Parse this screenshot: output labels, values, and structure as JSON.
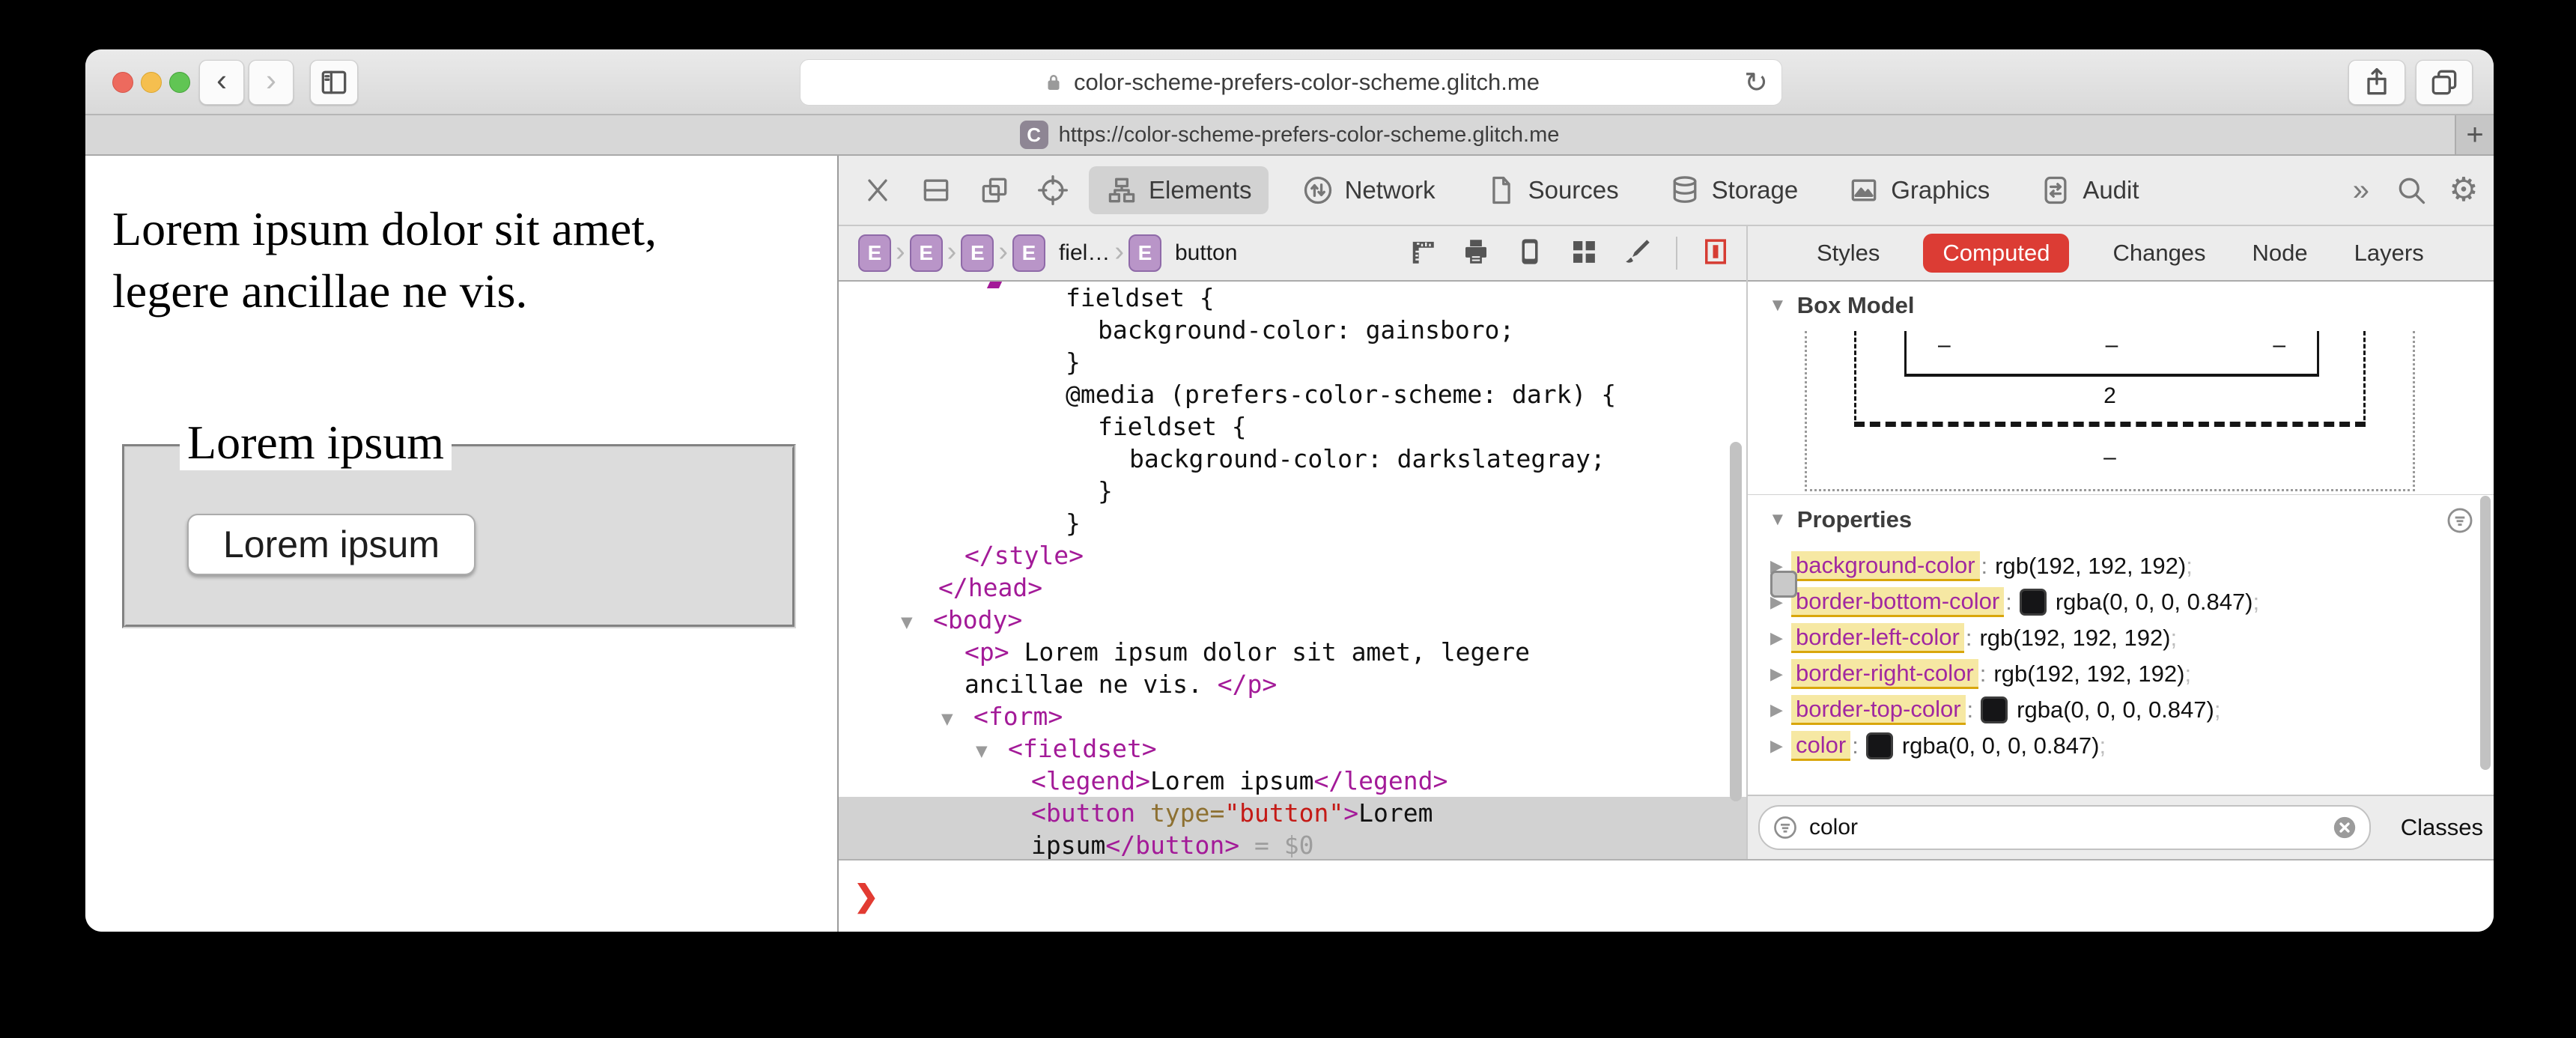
{
  "browser": {
    "back_glyph": "‹",
    "forward_glyph": "›",
    "url": "color-scheme-prefers-color-scheme.glitch.me",
    "reload_glyph": "↻",
    "tab": {
      "favicon_letter": "C",
      "url": "https://color-scheme-prefers-color-scheme.glitch.me"
    },
    "new_tab_glyph": "+"
  },
  "page": {
    "paragraph_line1": "Lorem ipsum dolor sit amet,",
    "paragraph_line2": "legere ancillae ne vis.",
    "fieldset_legend": "Lorem ipsum",
    "button_label": "Lorem ipsum"
  },
  "devtools": {
    "toolbar": {
      "left_buttons": [
        {
          "name": "close-devtools-button",
          "icon": "close-icon"
        },
        {
          "name": "dock-bottom-button",
          "icon": "dock-bottom-icon"
        },
        {
          "name": "dock-side-button",
          "icon": "dock-side-icon"
        },
        {
          "name": "inspect-element-button",
          "icon": "inspect-target-icon"
        }
      ],
      "tabs": [
        {
          "label": "Elements",
          "icon": "elements-icon",
          "selected": true
        },
        {
          "label": "Network",
          "icon": "network-icon",
          "selected": false
        },
        {
          "label": "Sources",
          "icon": "sources-icon",
          "selected": false
        },
        {
          "label": "Storage",
          "icon": "storage-icon",
          "selected": false
        },
        {
          "label": "Graphics",
          "icon": "graphics-icon",
          "selected": false
        },
        {
          "label": "Audit",
          "icon": "audit-icon",
          "selected": false
        }
      ],
      "overflow_glyph": "»",
      "right_buttons": [
        {
          "name": "search-button",
          "icon": "search-icon"
        },
        {
          "name": "settings-button",
          "icon": "gear-icon"
        }
      ]
    },
    "breadcrumb": {
      "badge_letter": "E",
      "separator_glyph": "›",
      "items": [
        {
          "label": ""
        },
        {
          "label": ""
        },
        {
          "label": ""
        },
        {
          "label": "fiel…"
        },
        {
          "label": "button"
        }
      ],
      "actions": [
        "ruler-icon",
        "printer-icon",
        "device-icon",
        "grid-icon",
        "brush-icon"
      ],
      "highlight_action": "element-highlight-icon"
    },
    "sidebar_tabs": [
      "Styles",
      "Computed",
      "Changes",
      "Node",
      "Layers"
    ],
    "sidebar_selected_tab": "Computed",
    "code": {
      "triangle_glyph": "▼",
      "lines": [
        {
          "indent": 303,
          "tri": false,
          "sel": false,
          "segs": [
            [
              "fieldset {",
              "plain"
            ]
          ]
        },
        {
          "indent": 346,
          "tri": false,
          "sel": false,
          "segs": [
            [
              "background-color: gainsboro;",
              "plain"
            ]
          ]
        },
        {
          "indent": 303,
          "tri": false,
          "sel": false,
          "segs": [
            [
              "}",
              "plain"
            ]
          ]
        },
        {
          "indent": 303,
          "tri": false,
          "sel": false,
          "segs": [
            [
              "@media (prefers-color-scheme: dark) {",
              "plain"
            ]
          ]
        },
        {
          "indent": 346,
          "tri": false,
          "sel": false,
          "segs": [
            [
              "fieldset {",
              "plain"
            ]
          ]
        },
        {
          "indent": 388,
          "tri": false,
          "sel": false,
          "segs": [
            [
              "background-color: darkslategray;",
              "plain"
            ]
          ]
        },
        {
          "indent": 346,
          "tri": false,
          "sel": false,
          "segs": [
            [
              "}",
              "plain"
            ]
          ]
        },
        {
          "indent": 303,
          "tri": false,
          "sel": false,
          "segs": [
            [
              "}",
              "plain"
            ]
          ]
        },
        {
          "indent": 168,
          "tri": false,
          "sel": false,
          "segs": [
            [
              "</style>",
              "tag"
            ]
          ]
        },
        {
          "indent": 133,
          "tri": false,
          "sel": false,
          "segs": [
            [
              "</head>",
              "tag"
            ]
          ]
        },
        {
          "indent": 83,
          "tri": true,
          "sel": false,
          "segs": [
            [
              "<body>",
              "tag"
            ]
          ]
        },
        {
          "indent": 168,
          "tri": false,
          "sel": false,
          "segs": [
            [
              "<p>",
              "tag"
            ],
            [
              " Lorem ipsum dolor sit amet, legere",
              "plain"
            ]
          ]
        },
        {
          "indent": 168,
          "tri": false,
          "sel": false,
          "segs": [
            [
              "ancillae ne vis. ",
              "plain"
            ],
            [
              "</p>",
              "tag"
            ]
          ]
        },
        {
          "indent": 137,
          "tri": true,
          "sel": false,
          "segs": [
            [
              "<form>",
              "tag"
            ]
          ]
        },
        {
          "indent": 183,
          "tri": true,
          "sel": false,
          "segs": [
            [
              "<fieldset>",
              "tag"
            ]
          ]
        },
        {
          "indent": 257,
          "tri": false,
          "sel": false,
          "segs": [
            [
              "<legend>",
              "tag"
            ],
            [
              "Lorem ipsum",
              "plain"
            ],
            [
              "</legend>",
              "tag"
            ]
          ]
        },
        {
          "indent": 257,
          "tri": false,
          "sel": true,
          "segs": [
            [
              "<button ",
              "tag"
            ],
            [
              "type",
              "attr"
            ],
            [
              "=",
              "attr"
            ],
            [
              "\"button\"",
              "val"
            ],
            [
              ">",
              "tag"
            ],
            [
              "Lorem",
              "plain"
            ]
          ]
        },
        {
          "indent": 257,
          "tri": false,
          "sel": true,
          "segs": [
            [
              "ipsum",
              "plain"
            ],
            [
              "</button>",
              "tag"
            ],
            [
              " = ",
              "meta"
            ],
            [
              "$0",
              "meta"
            ]
          ]
        }
      ]
    },
    "box_model": {
      "title": "Box Model",
      "top_dashes": [
        "–",
        "–",
        "–"
      ],
      "border_bottom_value": "2",
      "margin_bottom_value": "–"
    },
    "properties": {
      "title": "Properties",
      "rows": [
        {
          "name": "background-color",
          "value": "rgb(192, 192, 192)",
          "swatch": "light"
        },
        {
          "name": "border-bottom-color",
          "value": "rgba(0, 0, 0, 0.847)",
          "swatch": "dark"
        },
        {
          "name": "border-left-color",
          "value": "rgb(192, 192, 192)",
          "swatch": "light"
        },
        {
          "name": "border-right-color",
          "value": "rgb(192, 192, 192)",
          "swatch": "light"
        },
        {
          "name": "border-top-color",
          "value": "rgba(0, 0, 0, 0.847)",
          "swatch": "dark"
        },
        {
          "name": "color",
          "value": "rgba(0, 0, 0, 0.847)",
          "swatch": "dark"
        }
      ]
    },
    "filter": {
      "value": "color",
      "classes_label": "Classes"
    },
    "console": {
      "prompt_glyph": "❯"
    }
  },
  "colors": {
    "accent_red": "#dc3c34",
    "selection_gray": "#d2d2d2",
    "highlight_yellow": "#f6e8a3",
    "badge_purple": "#b995c8",
    "tag_purple": "#a31a98",
    "attr_olive": "#8d7031",
    "attr_value_red": "#c41a16",
    "console_prompt_red": "#e23b32",
    "fieldset_gainsboro": "#dcdcdc"
  }
}
